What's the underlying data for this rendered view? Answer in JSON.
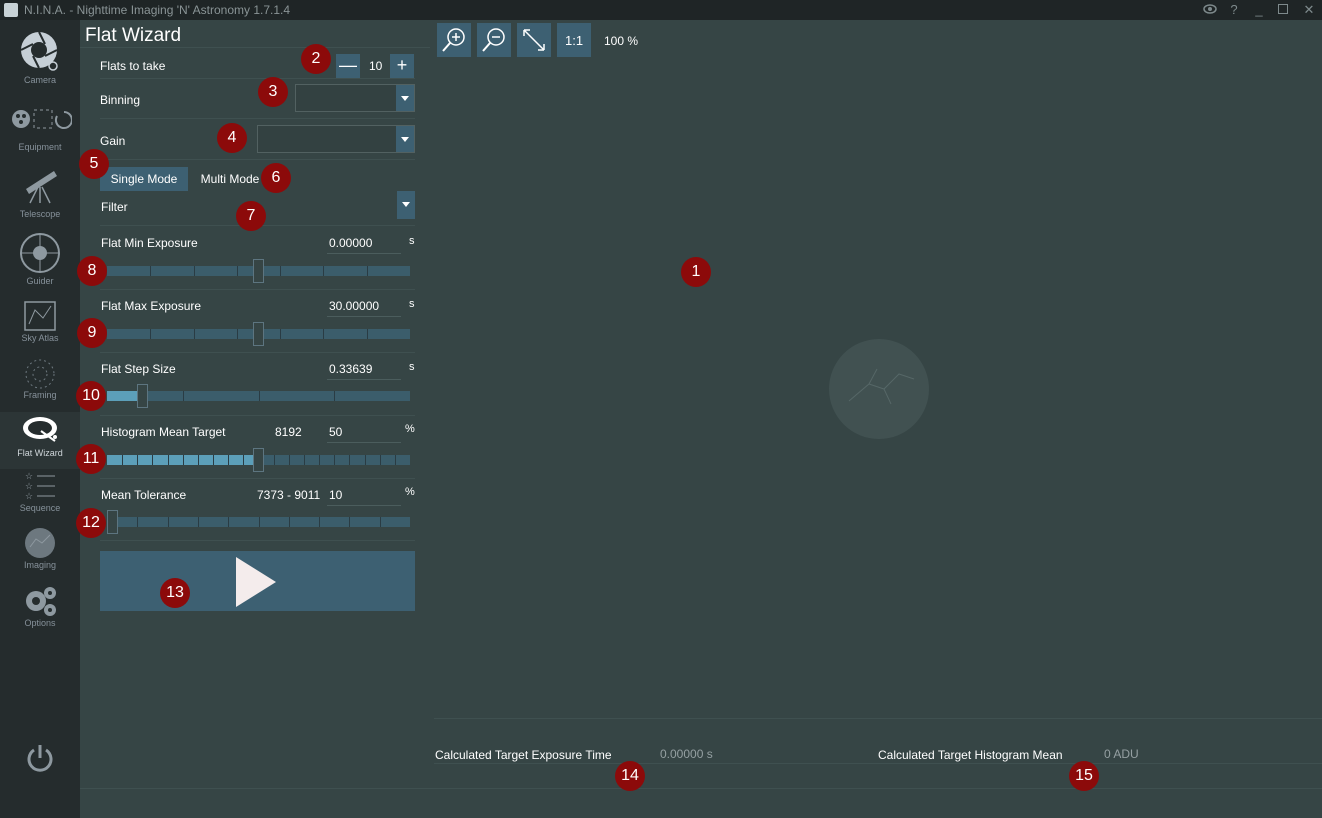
{
  "window": {
    "title": "N.I.N.A. - Nighttime Imaging 'N' Astronomy 1.7.1.4"
  },
  "sidebar": {
    "items": [
      {
        "label": "Camera"
      },
      {
        "label": "Equipment"
      },
      {
        "label": "Telescope"
      },
      {
        "label": "Guider"
      },
      {
        "label": "Sky Atlas"
      },
      {
        "label": "Framing"
      },
      {
        "label": "Flat Wizard"
      },
      {
        "label": "Sequence"
      },
      {
        "label": "Imaging"
      },
      {
        "label": "Options"
      }
    ]
  },
  "panel": {
    "title": "Flat Wizard",
    "flats_to_take": {
      "label": "Flats to take",
      "value": "10",
      "minus": "—",
      "plus": "+"
    },
    "binning": {
      "label": "Binning",
      "value": ""
    },
    "gain": {
      "label": "Gain",
      "value": ""
    },
    "modes": {
      "single": "Single Mode",
      "multi": "Multi Mode"
    },
    "filter": {
      "label": "Filter",
      "value": ""
    },
    "min_exposure": {
      "label": "Flat Min Exposure",
      "value": "0.00000",
      "unit": "s",
      "level": 0.5
    },
    "max_exposure": {
      "label": "Flat Max Exposure",
      "value": "30.00000",
      "unit": "s",
      "level": 0.5
    },
    "step_size": {
      "label": "Flat Step Size",
      "value": "0.33639",
      "unit": "s",
      "level": 0.12
    },
    "histogram_target": {
      "label": "Histogram Mean Target",
      "adu": "8192",
      "value": "50",
      "unit": "%",
      "level": 0.5
    },
    "mean_tolerance": {
      "label": "Mean Tolerance",
      "range": "7373 - 9011",
      "value": "10",
      "unit": "%",
      "level": 0.02
    }
  },
  "toolbar": {
    "zoom_level": "100 %",
    "one_to_one": "1:1"
  },
  "results": {
    "exposure_label": "Calculated Target Exposure Time",
    "exposure_value": "0.00000 s",
    "histogram_label": "Calculated Target Histogram Mean",
    "histogram_value": "0 ADU"
  },
  "markers": [
    "1",
    "2",
    "3",
    "4",
    "5",
    "6",
    "7",
    "8",
    "9",
    "10",
    "11",
    "12",
    "13",
    "14",
    "15"
  ],
  "colors": {
    "accent": "#3d6072",
    "slider_fill": "#5c9fb9",
    "marker": "#8c0a0a",
    "background": "#364545",
    "sidebar": "#252c2d"
  }
}
